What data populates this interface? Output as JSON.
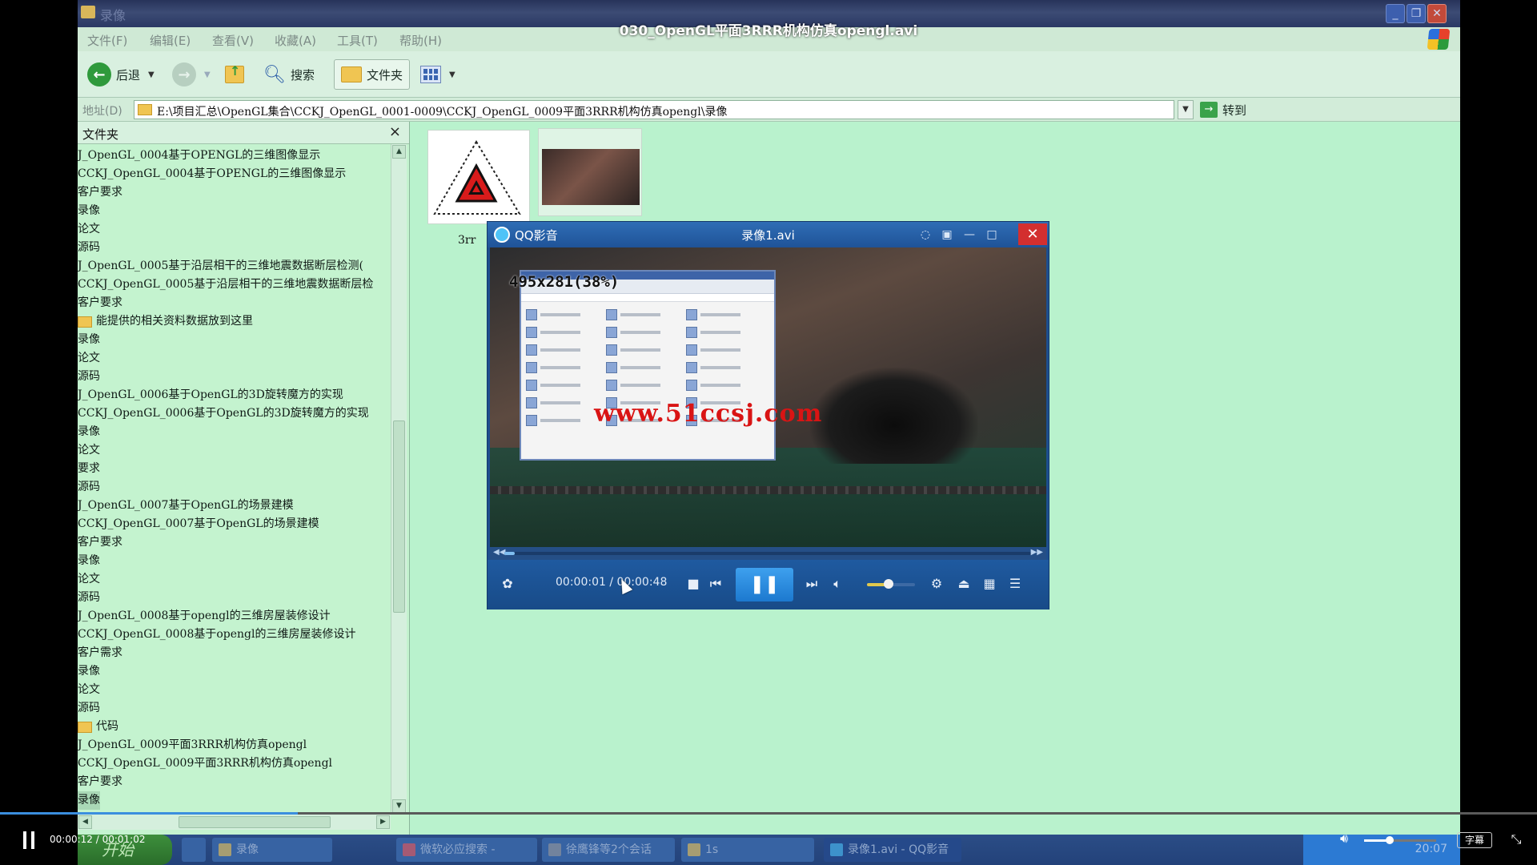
{
  "video_title": "030_OpenGL平面3RRR机构仿真opengl.avi",
  "explorer": {
    "window_title": "录像",
    "menu": [
      "文件(F)",
      "编辑(E)",
      "查看(V)",
      "收藏(A)",
      "工具(T)",
      "帮助(H)"
    ],
    "toolbar": {
      "back": "后退",
      "search": "搜索",
      "folders": "文件夹"
    },
    "address_label": "地址(D)",
    "address_value": "E:\\项目汇总\\OpenGL集合\\CCKJ_OpenGL_0001-0009\\CCKJ_OpenGL_0009平面3RRR机构仿真opengl\\录像",
    "go_label": "转到",
    "tree_title": "文件夹",
    "tree_items": [
      "J_OpenGL_0004基于OPENGL的三维图像显示",
      "CCKJ_OpenGL_0004基于OPENGL的三维图像显示",
      "客户要求",
      "录像",
      "论文",
      "源码",
      "J_OpenGL_0005基于沿层相干的三维地震数据断层检测(",
      "CCKJ_OpenGL_0005基于沿层相干的三维地震数据断层检",
      "客户要求",
      "能提供的相关资料数据放到这里",
      "录像",
      "论文",
      "源码",
      "J_OpenGL_0006基于OpenGL的3D旋转魔方的实现",
      "CCKJ_OpenGL_0006基于OpenGL的3D旋转魔方的实现",
      "录像",
      "论文",
      "要求",
      "源码",
      "J_OpenGL_0007基于OpenGL的场景建模",
      "CCKJ_OpenGL_0007基于OpenGL的场景建模",
      "客户要求",
      "录像",
      "论文",
      "源码",
      "J_OpenGL_0008基于opengl的三维房屋装修设计",
      "CCKJ_OpenGL_0008基于opengl的三维房屋装修设计",
      "客户需求",
      "录像",
      "论文",
      "源码",
      "代码",
      "J_OpenGL_0009平面3RRR机构仿真opengl",
      "CCKJ_OpenGL_0009平面3RRR机构仿真opengl",
      "客户要求",
      "录像"
    ],
    "tree_folder_rows": [
      9,
      31
    ],
    "tree_selected_row": 35,
    "thumb_label": "3rr"
  },
  "qq_player": {
    "app_name": "QQ影音",
    "file_name": "录像1.avi",
    "resolution_overlay": "495x281(38%)",
    "watermark": "www.51ccsj.com",
    "time": "00:00:01 / 00:00:48",
    "progress": 0.02,
    "volume": 0.45
  },
  "taskbar": {
    "start": "开始",
    "tasks": [
      "录像",
      "微软必应搜索 -",
      "徐鹰锋等2个会话",
      "1s",
      "录像1.avi - QQ影音"
    ],
    "clock": "20:07"
  },
  "outer_player": {
    "time": "00:00:12 / 00:01:02",
    "progress": 0.194,
    "volume": 0.35,
    "subtitle_btn": "字幕"
  },
  "colors": {
    "explorer_bg": "#b9f2cd",
    "qq_blue": "#1f5398",
    "accent": "#3b8ede"
  }
}
